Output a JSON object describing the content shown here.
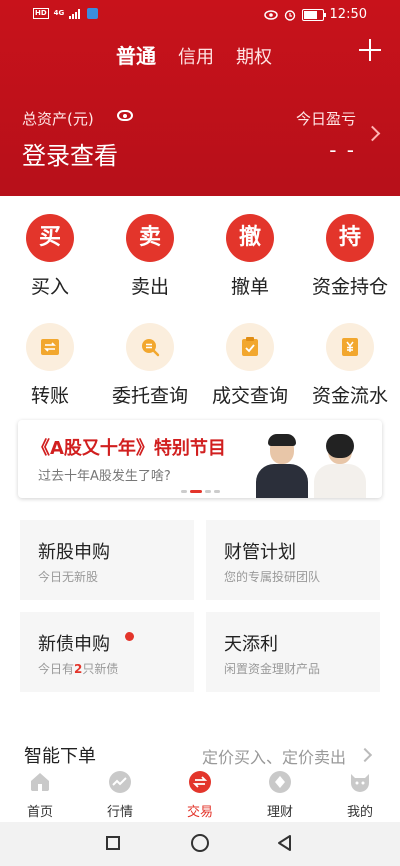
{
  "status_bar": {
    "time": "12:50",
    "network": "HD",
    "signal_label": "4G",
    "battery_level": 0.8
  },
  "header": {
    "tabs": [
      {
        "label": "普通",
        "active": true
      },
      {
        "label": "信用",
        "active": false
      },
      {
        "label": "期权",
        "active": false
      }
    ],
    "total_assets_label": "总资产(元)",
    "login_prompt": "登录查看",
    "today_pnl_label": "今日盈亏",
    "today_pnl_value": "- -"
  },
  "primary_actions": [
    {
      "glyph": "买",
      "label": "买入"
    },
    {
      "glyph": "卖",
      "label": "卖出"
    },
    {
      "glyph": "撤",
      "label": "撤单"
    },
    {
      "glyph": "持",
      "label": "资金持仓"
    }
  ],
  "secondary_actions": [
    {
      "icon": "transfer-icon",
      "label": "转账"
    },
    {
      "icon": "order-query-icon",
      "label": "委托查询"
    },
    {
      "icon": "deal-query-icon",
      "label": "成交查询"
    },
    {
      "icon": "cash-flow-icon",
      "label": "资金流水"
    }
  ],
  "banner": {
    "title": "《A股又十年》特别节目",
    "subtitle": "过去十年A股发生了啥?",
    "page_count": 4,
    "active_page": 1
  },
  "cards": [
    {
      "title": "新股申购",
      "subtitle": "今日无新股"
    },
    {
      "title": "财管计划",
      "subtitle": "您的专属投研团队"
    },
    {
      "title": "新债申购",
      "subtitle_prefix": "今日有",
      "subtitle_count": "2",
      "subtitle_suffix": "只新债",
      "has_badge": true
    },
    {
      "title": "天添利",
      "subtitle": "闲置资金理财产品"
    }
  ],
  "smart_order": {
    "title": "智能下单",
    "description": "定价买入、定价卖出"
  },
  "bottom_nav": [
    {
      "label": "首页",
      "icon": "home-icon",
      "active": false
    },
    {
      "label": "行情",
      "icon": "market-icon",
      "active": false
    },
    {
      "label": "交易",
      "icon": "trade-icon",
      "active": true
    },
    {
      "label": "理财",
      "icon": "wealth-icon",
      "active": false
    },
    {
      "label": "我的",
      "icon": "profile-icon",
      "active": false
    }
  ],
  "colors": {
    "brand_red": "#c8121b",
    "accent_red": "#e3352b",
    "cream": "#fbeedd"
  }
}
